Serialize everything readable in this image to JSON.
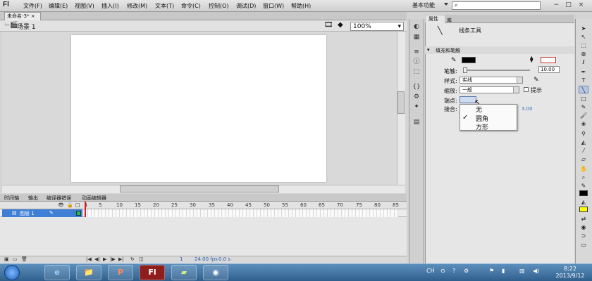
{
  "app": {
    "logo": "Fl"
  },
  "menu": [
    "文件(F)",
    "编辑(E)",
    "视图(V)",
    "插入(I)",
    "修改(M)",
    "文本(T)",
    "命令(C)",
    "控制(O)",
    "调试(D)",
    "窗口(W)",
    "帮助(H)"
  ],
  "workspace": "基本功能",
  "search": {
    "icon": "search-icon",
    "value": ""
  },
  "window_controls": [
    "−",
    "□",
    "×"
  ],
  "document_tab": "未命名-3*",
  "scene": {
    "label": "场景 1",
    "zoom": "100%"
  },
  "timeline": {
    "tabs": [
      "时间轴",
      "输出",
      "编译器错误",
      "动画编辑器"
    ],
    "ruler": [
      "1",
      "5",
      "10",
      "15",
      "20",
      "25",
      "30",
      "35",
      "40",
      "45",
      "50",
      "55",
      "60",
      "65",
      "70",
      "75",
      "80",
      "85"
    ],
    "layer_name": "图层 1",
    "status_frame": "1",
    "status_fps": "24.00 fps",
    "status_time": "0.0 s"
  },
  "properties": {
    "tabs": [
      "属性",
      "库"
    ],
    "tool_name": "线条工具",
    "section": "填充和笔触",
    "stroke_color": "#000000",
    "width_label": "笔触:",
    "width_value": "10.00",
    "style_label": "样式:",
    "style_value": "实线",
    "scale_label": "缩放:",
    "scale_value": "一般",
    "hint_label": "提示",
    "cap_label": "端点:",
    "join_label": "接合:",
    "join_value": "3.00",
    "cap_options": [
      "无",
      "圆角",
      "方形"
    ],
    "cap_selected": "圆角"
  },
  "taskbar": {
    "apps": [
      "e",
      "📁",
      "P",
      "Fl",
      "▰",
      "◉"
    ],
    "lang": "CH",
    "time": "8:22",
    "date": "2013/9/12"
  }
}
